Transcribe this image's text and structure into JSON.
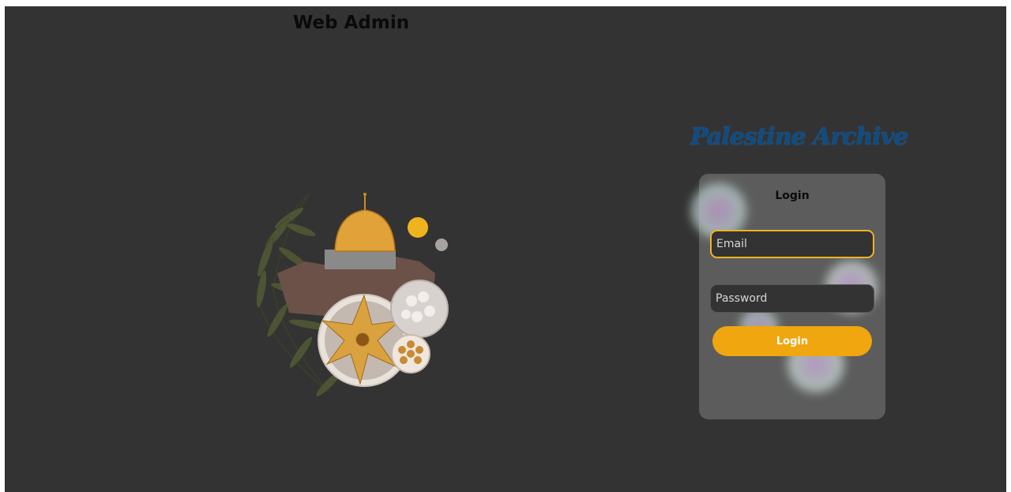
{
  "header": {
    "title": "Web Admin"
  },
  "brand": {
    "logo_text": "Palestine Archive",
    "color": "#0f4c81"
  },
  "illustration": {
    "icon": "palestine-collage-image"
  },
  "login_card": {
    "title": "Login",
    "email": {
      "placeholder": "Email",
      "value": ""
    },
    "password": {
      "placeholder": "Password",
      "value": ""
    },
    "submit_label": "Login"
  },
  "colors": {
    "background": "#333333",
    "card": "#5c5c5c",
    "accent": "#f0a60e",
    "focus_border": "#f0b323"
  }
}
